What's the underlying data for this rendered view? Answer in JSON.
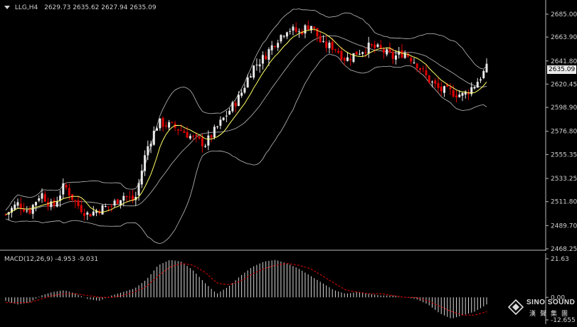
{
  "main_chart": {
    "symbol_timeframe": "LLG,H4",
    "ohlc": "2629.73 2635.62 2627.94 2635.09",
    "current_price": "2635.09",
    "price_axis": [
      "2685.00",
      "2663.90",
      "2641.80",
      "2620.45",
      "2598.90",
      "2576.80",
      "2555.35",
      "2533.25",
      "2511.80",
      "2489.70",
      "2468.25"
    ]
  },
  "macd": {
    "title": "MACD(12,26,9) -4.953 -9.031",
    "axis": [
      "21.63",
      "0.00",
      "-12.655"
    ]
  },
  "watermark": {
    "title": "SINO SOUND",
    "subtitle": "漢聲集團"
  },
  "colors": {
    "background": "#000000",
    "up_candle": "#e8e8e8",
    "down_candle": "#e00000",
    "bands": "#bdbdbd",
    "moving_average": "#ffff66",
    "macd_histogram": "#d8d8d8",
    "macd_signal": "#e00000"
  },
  "chart_data": [
    {
      "type": "candlestick",
      "title": "LLG,H4",
      "ylim": [
        2468.25,
        2685.0
      ],
      "close_path": [
        2500,
        2510,
        2503,
        2520,
        2506,
        2527,
        2510,
        2500,
        2505,
        2508,
        2518,
        2512,
        2560,
        2585,
        2582,
        2578,
        2570,
        2565,
        2580,
        2595,
        2610,
        2635,
        2645,
        2660,
        2672,
        2668,
        2676,
        2656,
        2655,
        2643,
        2650,
        2655,
        2652,
        2645,
        2650,
        2640,
        2625,
        2615,
        2613,
        2610,
        2620,
        2635
      ],
      "overlays": [
        "bollinger_bands",
        "moving_average"
      ]
    },
    {
      "type": "bar",
      "title": "MACD(12,26,9) -4.953 -9.031",
      "ylim": [
        -12.655,
        21.63
      ],
      "series": [
        {
          "name": "histogram",
          "values": [
            -2,
            -4,
            -3,
            1,
            3,
            4,
            2,
            -1,
            -2,
            1,
            3,
            5,
            10,
            18,
            21,
            20,
            15,
            8,
            2,
            6,
            12,
            17,
            20,
            21,
            19,
            16,
            12,
            8,
            4,
            2,
            3,
            2,
            1,
            1,
            0,
            -1,
            -4,
            -9,
            -12,
            -10,
            -8,
            -4
          ]
        },
        {
          "name": "signal",
          "values": [
            -3,
            -3,
            -3,
            -1,
            1,
            2,
            2,
            1,
            0,
            0,
            1,
            3,
            6,
            12,
            17,
            19,
            18,
            14,
            8,
            7,
            9,
            13,
            16,
            18,
            19,
            18,
            16,
            12,
            8,
            4,
            3,
            2,
            2,
            1,
            0,
            0,
            -2,
            -5,
            -8,
            -10,
            -10,
            -8
          ]
        }
      ]
    }
  ]
}
